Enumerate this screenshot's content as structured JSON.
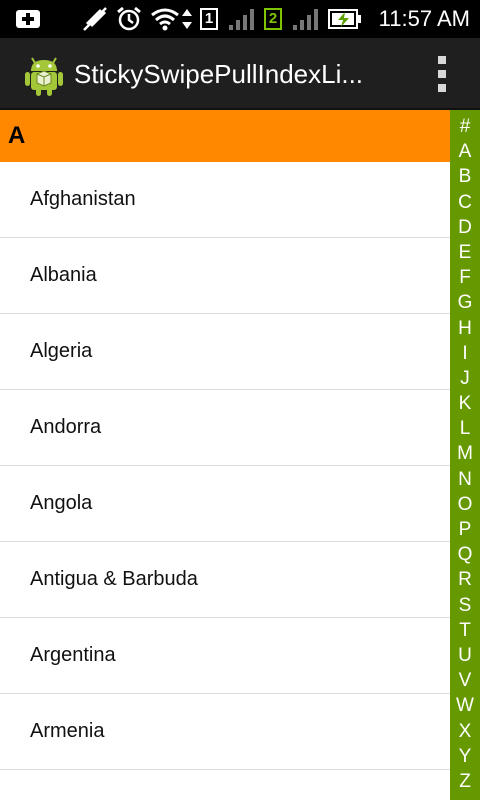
{
  "status_bar": {
    "time": "11:57 AM",
    "icons": [
      "notification-add-icon",
      "mute-icon",
      "alarm-icon",
      "wifi-icon",
      "data-transfer-icon",
      "sim1-icon",
      "signal1-icon",
      "sim2-icon",
      "signal2-icon",
      "battery-charging-icon"
    ],
    "sim1_label": "1",
    "sim2_label": "2"
  },
  "action_bar": {
    "title": "StickySwipePullIndexLi...",
    "app_icon": "android-icon",
    "overflow_icon": "overflow-menu-icon"
  },
  "list": {
    "section_header": "A",
    "items": [
      "Afghanistan",
      "Albania",
      "Algeria",
      "Andorra",
      "Angola",
      "Antigua & Barbuda",
      "Argentina",
      "Armenia"
    ]
  },
  "index_bar": [
    "#",
    "A",
    "B",
    "C",
    "D",
    "E",
    "F",
    "G",
    "H",
    "I",
    "J",
    "K",
    "L",
    "M",
    "N",
    "O",
    "P",
    "Q",
    "R",
    "S",
    "T",
    "U",
    "V",
    "W",
    "X",
    "Y",
    "Z"
  ],
  "colors": {
    "status_bar_bg": "#000000",
    "action_bar_bg": "#1f1f1f",
    "section_header_bg": "#ff8800",
    "index_bar_bg": "#669900"
  }
}
